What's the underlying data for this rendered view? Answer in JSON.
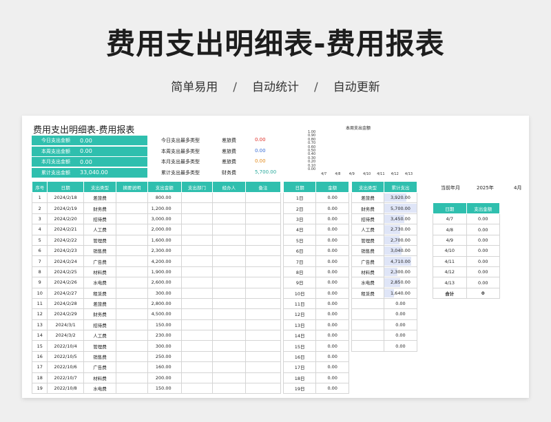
{
  "hero": {
    "title": "费用支出明细表-费用报表",
    "features": [
      "简单易用",
      "自动统计",
      "自动更新"
    ],
    "separator": "/"
  },
  "sheet": {
    "title": "费用支出明细表-费用报表",
    "summary": [
      {
        "label": "今日支出金额",
        "value": "0.00"
      },
      {
        "label": "本周支出金额",
        "value": "0.00"
      },
      {
        "label": "本月支出金额",
        "value": "0.00"
      },
      {
        "label": "累计支出金额",
        "value": "33,040.00"
      }
    ],
    "top_categories": [
      {
        "label": "今日支出最多类型",
        "type": "差旅费",
        "value": "0.00",
        "color": "#e0302a"
      },
      {
        "label": "本周支出最多类型",
        "type": "差旅费",
        "value": "0.00",
        "color": "#3b6fd6"
      },
      {
        "label": "本月支出最多类型",
        "type": "差旅费",
        "value": "0.00",
        "color": "#e28a1a"
      },
      {
        "label": "累计支出最多类型",
        "type": "财务费",
        "value": "5,700.00",
        "color": "#25a89a"
      }
    ],
    "chart_data": {
      "type": "bar",
      "title": "本周支出金额",
      "categories": [
        "4/7",
        "4/8",
        "4/9",
        "4/10",
        "4/11",
        "4/12",
        "4/13"
      ],
      "values": [
        0,
        0,
        0,
        0,
        0,
        0,
        0
      ],
      "yticks": [
        "1.00",
        "0.90",
        "0.80",
        "0.70",
        "0.60",
        "0.50",
        "0.40",
        "0.30",
        "0.20",
        "0.10",
        "0.00"
      ],
      "ylim": [
        0,
        1
      ]
    },
    "detail": {
      "headers": [
        "序号",
        "日期",
        "支出类型",
        "摘要说明",
        "支出金额",
        "支出部门",
        "经办人",
        "备注"
      ],
      "rows": [
        [
          "1",
          "2024/2/18",
          "差旅费",
          "800.00"
        ],
        [
          "2",
          "2024/2/19",
          "财务费",
          "1,200.00"
        ],
        [
          "3",
          "2024/2/20",
          "招待费",
          "3,000.00"
        ],
        [
          "4",
          "2024/2/21",
          "人工费",
          "2,000.00"
        ],
        [
          "5",
          "2024/2/22",
          "管理费",
          "1,600.00"
        ],
        [
          "6",
          "2024/2/23",
          "销售费",
          "2,300.00"
        ],
        [
          "7",
          "2024/2/24",
          "广告费",
          "4,200.00"
        ],
        [
          "8",
          "2024/2/25",
          "材料费",
          "1,900.00"
        ],
        [
          "9",
          "2024/2/26",
          "水电费",
          "2,600.00"
        ],
        [
          "10",
          "2024/2/27",
          "租赁费",
          "300.00"
        ],
        [
          "11",
          "2024/2/28",
          "差旅费",
          "2,800.00"
        ],
        [
          "12",
          "2024/2/29",
          "财务费",
          "4,500.00"
        ],
        [
          "13",
          "2024/3/1",
          "招待费",
          "150.00"
        ],
        [
          "14",
          "2024/3/2",
          "人工费",
          "230.00"
        ],
        [
          "15",
          "2022/10/4",
          "管理费",
          "300.00"
        ],
        [
          "16",
          "2022/10/5",
          "销售费",
          "250.00"
        ],
        [
          "17",
          "2022/10/6",
          "广告费",
          "160.00"
        ],
        [
          "18",
          "2022/10/7",
          "材料费",
          "200.00"
        ],
        [
          "19",
          "2022/10/8",
          "水电费",
          "150.00"
        ]
      ]
    },
    "daily": {
      "headers": [
        "日期",
        "金额"
      ],
      "rows": [
        [
          "1日",
          "0.00"
        ],
        [
          "2日",
          "0.00"
        ],
        [
          "3日",
          "0.00"
        ],
        [
          "4日",
          "0.00"
        ],
        [
          "5日",
          "0.00"
        ],
        [
          "6日",
          "0.00"
        ],
        [
          "7日",
          "0.00"
        ],
        [
          "8日",
          "0.00"
        ],
        [
          "9日",
          "0.00"
        ],
        [
          "10日",
          "0.00"
        ],
        [
          "11日",
          "0.00"
        ],
        [
          "12日",
          "0.00"
        ],
        [
          "13日",
          "0.00"
        ],
        [
          "14日",
          "0.00"
        ],
        [
          "15日",
          "0.00"
        ],
        [
          "16日",
          "0.00"
        ],
        [
          "17日",
          "0.00"
        ],
        [
          "18日",
          "0.00"
        ],
        [
          "19日",
          "0.00"
        ]
      ]
    },
    "category_totals": {
      "headers": [
        "支出类型",
        "累计支出"
      ],
      "rows": [
        {
          "type": "差旅费",
          "amount": "3,920.00",
          "share": 0.69
        },
        {
          "type": "财务费",
          "amount": "5,700.00",
          "share": 1.0
        },
        {
          "type": "招待费",
          "amount": "3,450.00",
          "share": 0.61
        },
        {
          "type": "人工费",
          "amount": "2,730.00",
          "share": 0.48
        },
        {
          "type": "管理费",
          "amount": "2,700.00",
          "share": 0.47
        },
        {
          "type": "销售费",
          "amount": "3,040.00",
          "share": 0.53
        },
        {
          "type": "广告费",
          "amount": "4,710.00",
          "share": 0.83
        },
        {
          "type": "材料费",
          "amount": "2,300.00",
          "share": 0.4
        },
        {
          "type": "水电费",
          "amount": "2,850.00",
          "share": 0.5
        },
        {
          "type": "租赁费",
          "amount": "1,640.00",
          "share": 0.29
        },
        {
          "type": "",
          "amount": "0.00",
          "share": 0
        },
        {
          "type": "",
          "amount": "0.00",
          "share": 0
        },
        {
          "type": "",
          "amount": "0.00",
          "share": 0
        },
        {
          "type": "",
          "amount": "0.00",
          "share": 0
        },
        {
          "type": "",
          "amount": "0.00",
          "share": 0
        }
      ]
    },
    "current": {
      "label": "当前年月",
      "year": "2025年",
      "month": "4月"
    },
    "weekly": {
      "headers": [
        "日期",
        "支出金额"
      ],
      "rows": [
        [
          "4/7",
          "0.00"
        ],
        [
          "4/8",
          "0.00"
        ],
        [
          "4/9",
          "0.00"
        ],
        [
          "4/10",
          "0.00"
        ],
        [
          "4/11",
          "0.00"
        ],
        [
          "4/12",
          "0.00"
        ],
        [
          "4/13",
          "0.00"
        ]
      ],
      "total": [
        "合计",
        "0"
      ]
    },
    "colors": {
      "accent": "#2fbfae",
      "bar_fill": "#dfe5f7"
    }
  }
}
